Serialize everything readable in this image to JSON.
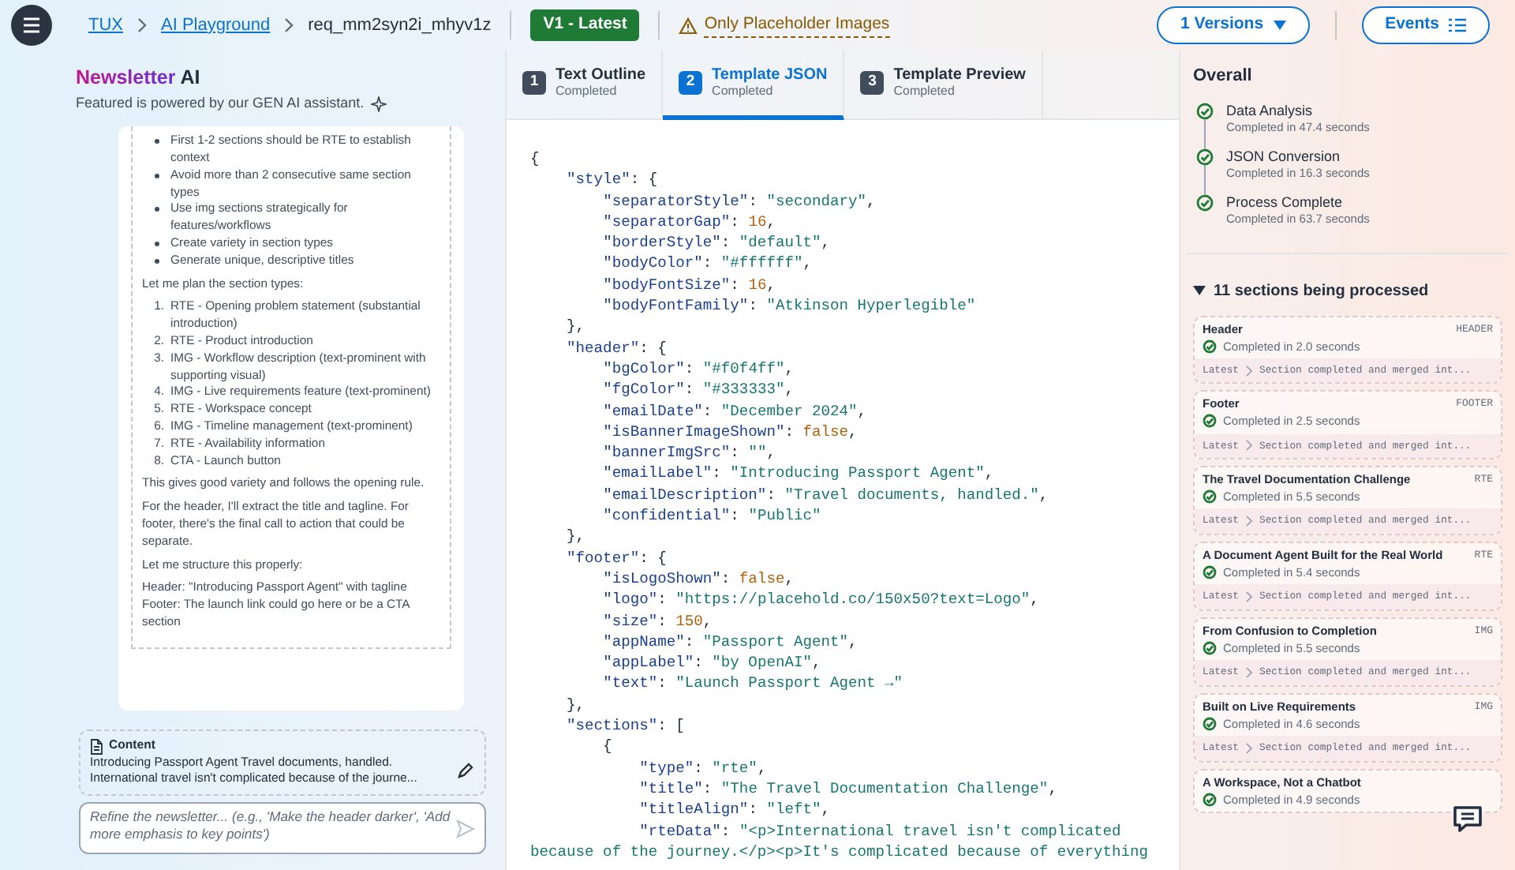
{
  "breadcrumb": [
    {
      "label": "TUX",
      "kind": "link"
    },
    {
      "label": "AI Playground",
      "kind": "link"
    },
    {
      "label": "req_mm2syn2i_mhyv1z",
      "kind": "current"
    }
  ],
  "version_badge": "V1 - Latest",
  "warning": "Only Placeholder Images",
  "versions_button": "1 Versions",
  "events_button": "Events",
  "assistant": {
    "title_accent": "Newsletter",
    "title_rest": "AI",
    "subtitle": "Featured is powered by our GEN AI assistant."
  },
  "reasoning": [
    {
      "kind": "bullets",
      "items": [
        "First 1-2 sections should be RTE to establish context",
        "Avoid more than 2 consecutive same section types",
        "Use img sections strategically for features/workflows",
        "Create variety in section types",
        "Generate unique, descriptive titles"
      ]
    },
    {
      "kind": "paragraph",
      "text": "Let me plan the section types:"
    },
    {
      "kind": "numbered",
      "items": [
        {
          "number": "1.",
          "text": "RTE - Opening problem statement (substantial introduction)"
        },
        {
          "number": "2.",
          "text": "RTE - Product introduction"
        },
        {
          "number": "3.",
          "text": "IMG - Workflow description (text-prominent with supporting visual)"
        },
        {
          "number": "4.",
          "text": "IMG - Live requirements feature (text-prominent)"
        },
        {
          "number": "5.",
          "text": "RTE - Workspace concept"
        },
        {
          "number": "6.",
          "text": "IMG - Timeline management (text-prominent)"
        },
        {
          "number": "7.",
          "text": "RTE - Availability information"
        },
        {
          "number": "8.",
          "text": "CTA - Launch button"
        }
      ]
    },
    {
      "kind": "paragraph",
      "text": "This gives good variety and follows the opening rule."
    },
    {
      "kind": "paragraph",
      "text": "For the header, I'll extract the title and tagline. For footer, there's the final call to action that could be separate."
    },
    {
      "kind": "paragraph",
      "text": "Let me structure this properly:"
    },
    {
      "kind": "lines",
      "items": [
        "Header: \"Introducing Passport Agent\" with tagline",
        "Footer: The launch link could go here or be a CTA section"
      ]
    }
  ],
  "content": {
    "label": "Content",
    "text": "Introducing Passport Agent Travel documents, handled. International travel isn't complicated because of the journe..."
  },
  "refine": {
    "placeholder": "Refine the newsletter... (e.g., 'Make the header darker', 'Add more emphasis to key points')"
  },
  "tabs": [
    {
      "number": "1",
      "label": "Text Outline",
      "status": "Completed",
      "selected": false
    },
    {
      "number": "2",
      "label": "Template JSON",
      "status": "Completed",
      "selected": true
    },
    {
      "number": "3",
      "label": "Template Preview",
      "status": "Completed",
      "selected": false
    }
  ],
  "code": [
    {
      "kind": "code",
      "text": "{"
    },
    {
      "kind": "code",
      "text": "    \"style\": {"
    },
    {
      "kind": "code",
      "text": "        \"separatorStyle\": \"secondary\","
    },
    {
      "kind": "code",
      "text": "        \"separatorGap\": 16,"
    },
    {
      "kind": "code",
      "text": "        \"borderStyle\": \"default\","
    },
    {
      "kind": "code",
      "text": "        \"bodyColor\": \"#ffffff\","
    },
    {
      "kind": "code",
      "text": "        \"bodyFontSize\": 16,"
    },
    {
      "kind": "code",
      "text": "        \"bodyFontFamily\": \"Atkinson Hyperlegible\""
    },
    {
      "kind": "code",
      "text": "    },"
    },
    {
      "kind": "code",
      "text": "    \"header\": {"
    },
    {
      "kind": "code",
      "text": "        \"bgColor\": \"#f0f4ff\","
    },
    {
      "kind": "code",
      "text": "        \"fgColor\": \"#333333\","
    },
    {
      "kind": "code",
      "text": "        \"emailDate\": \"December 2024\","
    },
    {
      "kind": "code",
      "text": "        \"isBannerImageShown\": false,"
    },
    {
      "kind": "code",
      "text": "        \"bannerImgSrc\": \"\","
    },
    {
      "kind": "code",
      "text": "        \"emailLabel\": \"Introducing Passport Agent\","
    },
    {
      "kind": "code",
      "text": "        \"emailDescription\": \"Travel documents, handled.\","
    },
    {
      "kind": "code",
      "text": "        \"confidential\": \"Public\""
    },
    {
      "kind": "code",
      "text": "    },"
    },
    {
      "kind": "code",
      "text": "    \"footer\": {"
    },
    {
      "kind": "code",
      "text": "        \"isLogoShown\": false,"
    },
    {
      "kind": "code",
      "text": "        \"logo\": \"https://placehold.co/150x50?text=Logo\","
    },
    {
      "kind": "code",
      "text": "        \"size\": 150,"
    },
    {
      "kind": "code",
      "text": "        \"appName\": \"Passport Agent\","
    },
    {
      "kind": "code",
      "text": "        \"appLabel\": \"by OpenAI\","
    },
    {
      "kind": "code",
      "text": "        \"text\": \"Launch Passport Agent →\""
    },
    {
      "kind": "code",
      "text": "    },"
    },
    {
      "kind": "code",
      "text": "    \"sections\": ["
    },
    {
      "kind": "code",
      "text": "        {"
    },
    {
      "kind": "code",
      "text": "            \"type\": \"rte\","
    },
    {
      "kind": "code",
      "text": "            \"title\": \"The Travel Documentation Challenge\","
    },
    {
      "kind": "code",
      "text": "            \"titleAlign\": \"left\","
    },
    {
      "kind": "code",
      "text": "            \"rteData\": \"<p>International travel isn't complicated"
    },
    {
      "kind": "string",
      "text": "because of the journey.</p><p>It's complicated because of everything"
    }
  ],
  "overall": {
    "title": "Overall",
    "steps": [
      {
        "label": "Data Analysis",
        "time": "Completed in 47.4 seconds"
      },
      {
        "label": "JSON Conversion",
        "time": "Completed in 16.3 seconds"
      },
      {
        "label": "Process Complete",
        "time": "Completed in 63.7 seconds"
      }
    ]
  },
  "sections_panel": {
    "title": "11 sections being processed",
    "expanded": true,
    "items": [
      {
        "title": "Header",
        "type": "HEADER",
        "time": "Completed in 2.0 seconds",
        "latest": "Latest",
        "message": "Section completed and merged int..."
      },
      {
        "title": "Footer",
        "type": "FOOTER",
        "time": "Completed in 2.5 seconds",
        "latest": "Latest",
        "message": "Section completed and merged int..."
      },
      {
        "title": "The Travel Documentation Challenge",
        "type": "RTE",
        "time": "Completed in 5.5 seconds",
        "latest": "Latest",
        "message": "Section completed and merged int..."
      },
      {
        "title": "A Document Agent Built for the Real World",
        "type": "RTE",
        "time": "Completed in 5.4 seconds",
        "latest": "Latest",
        "message": "Section completed and merged int..."
      },
      {
        "title": "From Confusion to Completion",
        "type": "IMG",
        "time": "Completed in 5.5 seconds",
        "latest": "Latest",
        "message": "Section completed and merged int..."
      },
      {
        "title": "Built on Live Requirements",
        "type": "IMG",
        "time": "Completed in 4.6 seconds",
        "latest": "Latest",
        "message": "Section completed and merged int..."
      },
      {
        "title": "A Workspace, Not a Chatbot",
        "time": "Completed in 4.9 seconds"
      }
    ]
  }
}
